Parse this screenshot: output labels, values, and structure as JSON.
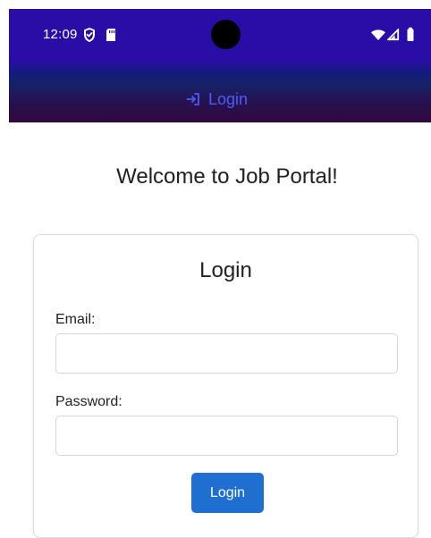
{
  "status_bar": {
    "time": "12:09",
    "left_icons": [
      "shield-icon",
      "sd-card-icon"
    ],
    "right_icons": [
      "wifi-icon",
      "signal-icon",
      "battery-icon"
    ]
  },
  "nav": {
    "login_label": "Login",
    "login_icon": "login-icon",
    "accent_color": "#4a5cff"
  },
  "page": {
    "welcome_title": "Welcome to Job Portal!"
  },
  "login_form": {
    "title": "Login",
    "email_label": "Email:",
    "email_value": "",
    "email_placeholder": "",
    "password_label": "Password:",
    "password_value": "",
    "password_placeholder": "",
    "submit_label": "Login",
    "button_color": "#1f6fd1"
  }
}
